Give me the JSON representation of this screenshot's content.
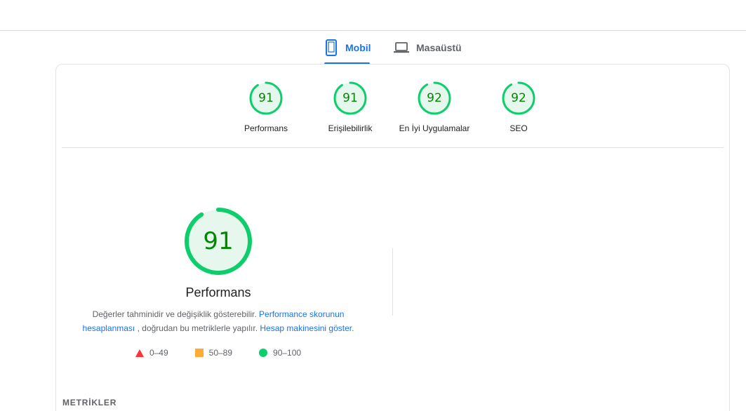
{
  "tabs": {
    "mobile": "Mobil",
    "desktop": "Masaüstü"
  },
  "categories": [
    {
      "score": "91",
      "value": 91,
      "label": "Performans"
    },
    {
      "score": "91",
      "value": 91,
      "label": "Erişilebilirlik"
    },
    {
      "score": "92",
      "value": 92,
      "label": "En İyi Uygulamalar"
    },
    {
      "score": "92",
      "value": 92,
      "label": "SEO"
    }
  ],
  "performance": {
    "score": "91",
    "value": 91,
    "title": "Performans",
    "desc_text_1": "Değerler tahminidir ve değişiklik gösterebilir.",
    "desc_link_1": "Performance skorunun hesaplanması",
    "desc_text_2": ", doğrudan bu metriklerle yapılır.",
    "desc_link_2": "Hesap makinesini göster",
    "desc_text_3": "."
  },
  "legend": [
    {
      "range": "0–49",
      "shape": "triangle",
      "color": "#ff3333"
    },
    {
      "range": "50–89",
      "shape": "square",
      "color": "#ffaa33"
    },
    {
      "range": "90–100",
      "shape": "circle",
      "color": "#0cce6b"
    }
  ],
  "metrics_heading": "METRİKLER",
  "colors": {
    "accent": "#1a73e8",
    "pass": "#0cce6b",
    "pass_text": "#008800",
    "pass_fill": "#e6f8ed"
  }
}
